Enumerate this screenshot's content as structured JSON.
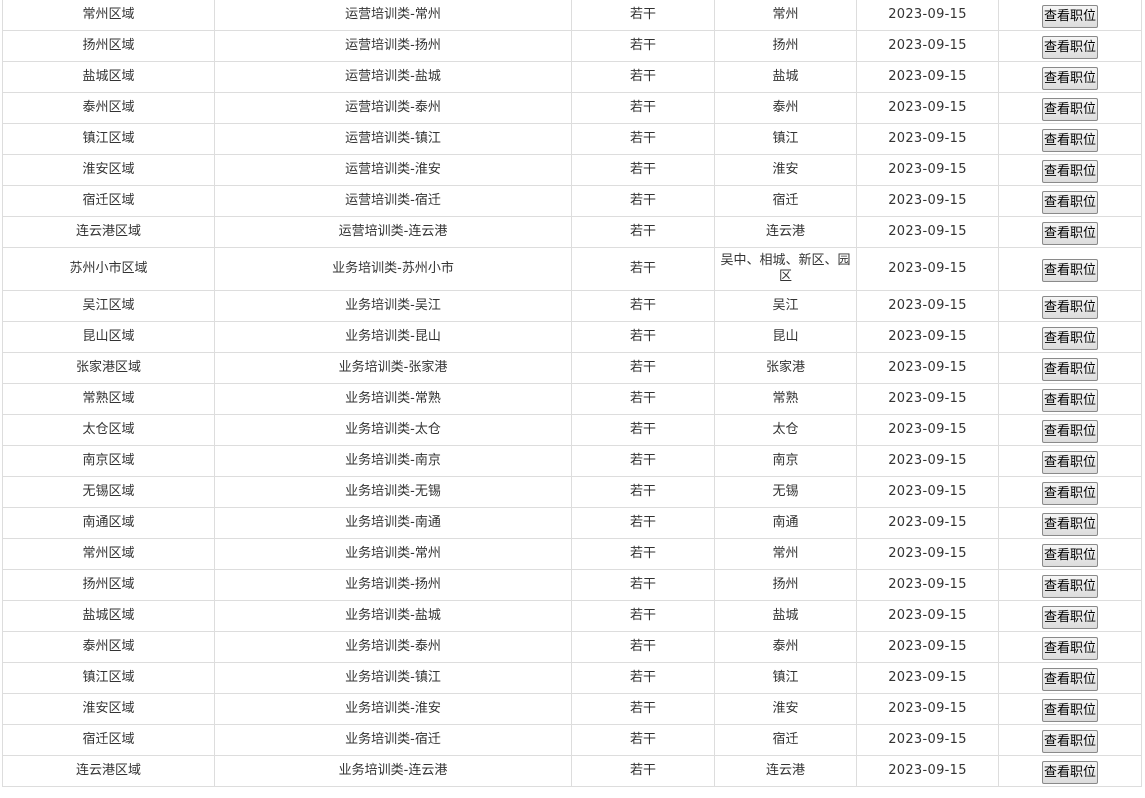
{
  "button_label": "查看职位",
  "rows": [
    {
      "region": "常州区域",
      "position": "运营培训类-常州",
      "headcount": "若干",
      "location": "常州",
      "date": "2023-09-15"
    },
    {
      "region": "扬州区域",
      "position": "运营培训类-扬州",
      "headcount": "若干",
      "location": "扬州",
      "date": "2023-09-15"
    },
    {
      "region": "盐城区域",
      "position": "运营培训类-盐城",
      "headcount": "若干",
      "location": "盐城",
      "date": "2023-09-15"
    },
    {
      "region": "泰州区域",
      "position": "运营培训类-泰州",
      "headcount": "若干",
      "location": "泰州",
      "date": "2023-09-15"
    },
    {
      "region": "镇江区域",
      "position": "运营培训类-镇江",
      "headcount": "若干",
      "location": "镇江",
      "date": "2023-09-15"
    },
    {
      "region": "淮安区域",
      "position": "运营培训类-淮安",
      "headcount": "若干",
      "location": "淮安",
      "date": "2023-09-15"
    },
    {
      "region": "宿迁区域",
      "position": "运营培训类-宿迁",
      "headcount": "若干",
      "location": "宿迁",
      "date": "2023-09-15"
    },
    {
      "region": "连云港区域",
      "position": "运营培训类-连云港",
      "headcount": "若干",
      "location": "连云港",
      "date": "2023-09-15"
    },
    {
      "region": "苏州小市区域",
      "position": "业务培训类-苏州小市",
      "headcount": "若干",
      "location": "吴中、相城、新区、园区",
      "date": "2023-09-15"
    },
    {
      "region": "吴江区域",
      "position": "业务培训类-吴江",
      "headcount": "若干",
      "location": "吴江",
      "date": "2023-09-15"
    },
    {
      "region": "昆山区域",
      "position": "业务培训类-昆山",
      "headcount": "若干",
      "location": "昆山",
      "date": "2023-09-15"
    },
    {
      "region": "张家港区域",
      "position": "业务培训类-张家港",
      "headcount": "若干",
      "location": "张家港",
      "date": "2023-09-15"
    },
    {
      "region": "常熟区域",
      "position": "业务培训类-常熟",
      "headcount": "若干",
      "location": "常熟",
      "date": "2023-09-15"
    },
    {
      "region": "太仓区域",
      "position": "业务培训类-太仓",
      "headcount": "若干",
      "location": "太仓",
      "date": "2023-09-15"
    },
    {
      "region": "南京区域",
      "position": "业务培训类-南京",
      "headcount": "若干",
      "location": "南京",
      "date": "2023-09-15"
    },
    {
      "region": "无锡区域",
      "position": "业务培训类-无锡",
      "headcount": "若干",
      "location": "无锡",
      "date": "2023-09-15"
    },
    {
      "region": "南通区域",
      "position": "业务培训类-南通",
      "headcount": "若干",
      "location": "南通",
      "date": "2023-09-15"
    },
    {
      "region": "常州区域",
      "position": "业务培训类-常州",
      "headcount": "若干",
      "location": "常州",
      "date": "2023-09-15"
    },
    {
      "region": "扬州区域",
      "position": "业务培训类-扬州",
      "headcount": "若干",
      "location": "扬州",
      "date": "2023-09-15"
    },
    {
      "region": "盐城区域",
      "position": "业务培训类-盐城",
      "headcount": "若干",
      "location": "盐城",
      "date": "2023-09-15"
    },
    {
      "region": "泰州区域",
      "position": "业务培训类-泰州",
      "headcount": "若干",
      "location": "泰州",
      "date": "2023-09-15"
    },
    {
      "region": "镇江区域",
      "position": "业务培训类-镇江",
      "headcount": "若干",
      "location": "镇江",
      "date": "2023-09-15"
    },
    {
      "region": "淮安区域",
      "position": "业务培训类-淮安",
      "headcount": "若干",
      "location": "淮安",
      "date": "2023-09-15"
    },
    {
      "region": "宿迁区域",
      "position": "业务培训类-宿迁",
      "headcount": "若干",
      "location": "宿迁",
      "date": "2023-09-15"
    },
    {
      "region": "连云港区域",
      "position": "业务培训类-连云港",
      "headcount": "若干",
      "location": "连云港",
      "date": "2023-09-15"
    }
  ]
}
